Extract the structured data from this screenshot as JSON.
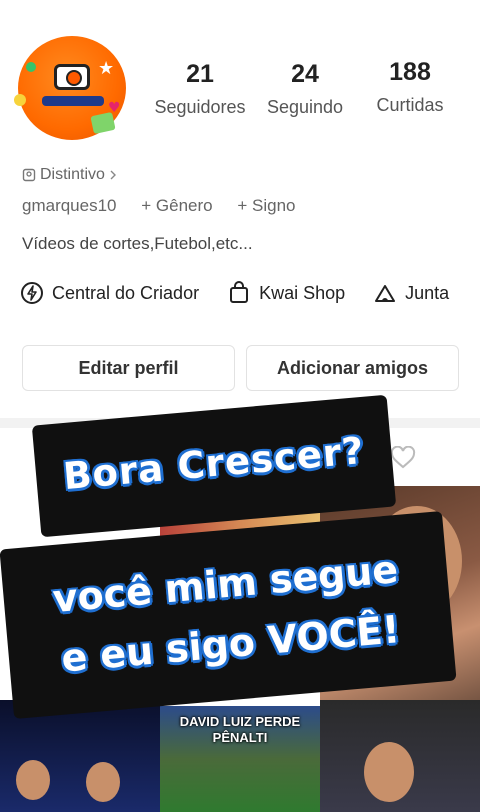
{
  "profile": {
    "username": "gmarques10",
    "badge_label": "Distintivo",
    "gender_label": "+ Gênero",
    "sign_label": "+ Signo",
    "bio": "Vídeos de cortes,Futebol,etc..."
  },
  "stats": [
    {
      "value": "21",
      "label": "Seguidores"
    },
    {
      "value": "24",
      "label": "Seguindo"
    },
    {
      "value": "188",
      "label": "Curtidas"
    }
  ],
  "links": [
    {
      "label": "Central do Criador",
      "icon": "lightning-circle-icon"
    },
    {
      "label": "Kwai Shop",
      "icon": "shopping-bag-icon"
    },
    {
      "label": "Junta",
      "icon": "tent-icon"
    }
  ],
  "buttons": {
    "edit_profile": "Editar perfil",
    "add_friends": "Adicionar amigos"
  },
  "overlay": {
    "line1": "Bora Crescer?",
    "line2": "você mim segue",
    "line3": "e eu sigo VOCÊ!"
  },
  "thumbnails": {
    "caption_line1": "DAVID LUIZ PERDE",
    "caption_line2": "PÊNALTI"
  },
  "colors": {
    "overlay_bg": "#101010",
    "overlay_outline": "#1f6fd1",
    "avatar_orange": "#ff6a00"
  }
}
